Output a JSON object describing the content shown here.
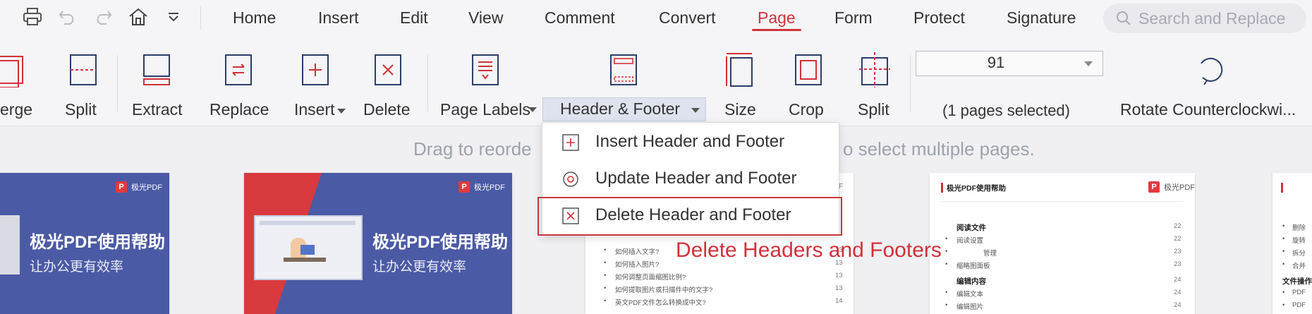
{
  "menu": {
    "items": [
      "Home",
      "Insert",
      "Edit",
      "View",
      "Comment",
      "Convert",
      "Page",
      "Form",
      "Protect",
      "Signature"
    ],
    "active": "Page"
  },
  "search": {
    "placeholder": "Search and Replace"
  },
  "quick_access": [
    "print-icon",
    "undo-icon",
    "redo-icon",
    "home-icon",
    "dropdown-icon"
  ],
  "ribbon": {
    "merge": "erge",
    "split": "Split",
    "extract": "Extract",
    "replace": "Replace",
    "insert": "Insert",
    "delete": "Delete",
    "page_labels": "Page Labels",
    "header_footer": "Header & Footer",
    "size": "Size",
    "crop": "Crop",
    "split2": "Split",
    "page_number": "91",
    "pages_selected": "(1 pages selected)",
    "rotate_ccw": "Rotate Counterclockwi..."
  },
  "hint": {
    "left": "Drag to reorde",
    "right": "o select multiple pages."
  },
  "dropdown": {
    "insert": "Insert Header and Footer",
    "update": "Update Header and Footer",
    "delete": "Delete Header and Footer"
  },
  "annotation": "Delete Headers and Footers",
  "thumbnails": {
    "brand": "极光PDF",
    "brand_logo": "P",
    "cover_title": "极光PDF使用帮助",
    "cover_sub": "让办公更有效率",
    "toc_header_title": "极光PDF使用帮助",
    "toc_rows": [
      {
        "text": "如何插入文字?",
        "num": "13"
      },
      {
        "text": "如何插入图片?",
        "num": "13"
      },
      {
        "text": "如何调整页面缩图比例?",
        "num": "13"
      },
      {
        "text": "如何提取图片或扫描件中的文字?",
        "num": "13"
      },
      {
        "text": "英文PDF文件怎么转换成中文?",
        "num": "14"
      }
    ],
    "toc4": [
      {
        "text": "阅读文件",
        "num": "22",
        "head": true
      },
      {
        "text": "阅读设置",
        "num": "22",
        "head": false
      },
      {
        "text": "管理",
        "num": "23",
        "head": false
      },
      {
        "text": "缩略图面板",
        "num": "23",
        "head": false
      },
      {
        "text": "编辑内容",
        "num": "24",
        "head": true
      },
      {
        "text": "编辑文本",
        "num": "24",
        "head": false
      },
      {
        "text": "编辑图片",
        "num": "24",
        "head": false
      }
    ],
    "toc5": [
      {
        "text": "删除",
        "head": false
      },
      {
        "text": "旋转",
        "head": false
      },
      {
        "text": "拆分",
        "head": false
      },
      {
        "text": "合并",
        "head": false
      },
      {
        "text": "文件操作",
        "head": true
      },
      {
        "text": "PDF",
        "head": false
      },
      {
        "text": "PDF",
        "head": false
      }
    ]
  },
  "colors": {
    "accent": "#d0323a",
    "cover_blue": "#4b5aa5",
    "brand_red": "#e03a3e"
  }
}
